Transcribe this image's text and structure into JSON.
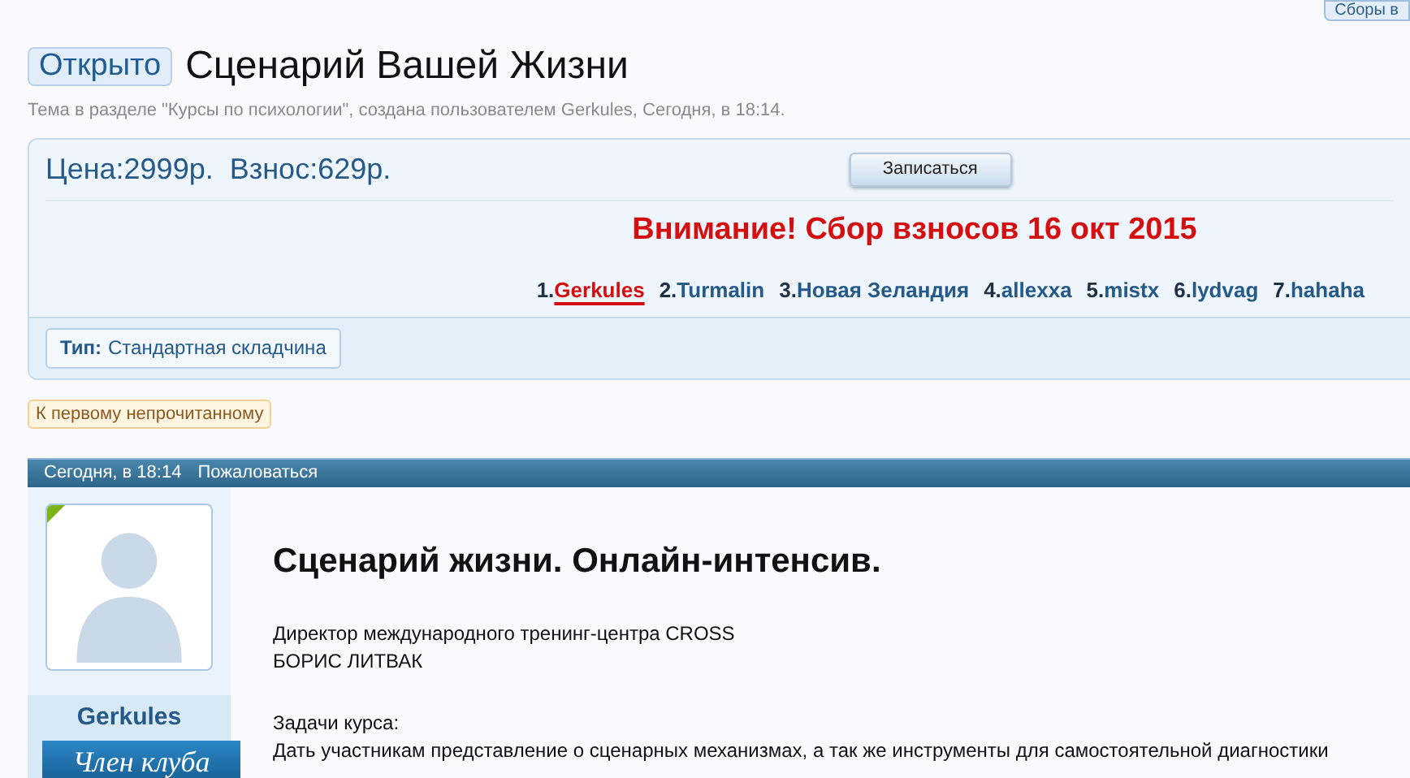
{
  "top_button": "Сборы в",
  "thread": {
    "status": "Открыто",
    "title": "Сценарий Вашей Жизни",
    "meta": "Тема в разделе \"Курсы по психологии\", создана пользователем Gerkules, Сегодня, в 18:14."
  },
  "panel": {
    "price_label": "Цена:",
    "price": "2999р.",
    "fee_label": "Взнос:",
    "fee": "629р.",
    "join_button": "Записаться",
    "notice": "Внимание! Сбор взносов 16 окт 2015",
    "participants": [
      {
        "number": "1.",
        "name": "Gerkules",
        "selected": true
      },
      {
        "number": "2.",
        "name": "Turmalin",
        "selected": false
      },
      {
        "number": "3.",
        "name": "Новая Зеландия",
        "selected": false
      },
      {
        "number": "4.",
        "name": "allexxa",
        "selected": false
      },
      {
        "number": "5.",
        "name": "mistx",
        "selected": false
      },
      {
        "number": "6.",
        "name": "lydvag",
        "selected": false
      },
      {
        "number": "7.",
        "name": "hahaha",
        "selected": false
      }
    ],
    "type_label": "Тип:",
    "type_value": "Стандартная складчина"
  },
  "first_unread_button": "К первому непрочитанному",
  "post": {
    "date": "Сегодня, в 18:14",
    "report_link": "Пожаловаться",
    "author": "Gerkules",
    "member_banner": "Член клуба",
    "heading": "Сценарий жизни. Онлайн-интенсив.",
    "paragraphs": [
      [
        "Директор международного тренинг-центра CROSS",
        "БОРИС ЛИТВАК"
      ],
      [
        "Задачи курса:",
        "Дать участникам представление о сценарных механизмах, а так же инструменты для самостоятельной диагностики"
      ]
    ]
  }
}
